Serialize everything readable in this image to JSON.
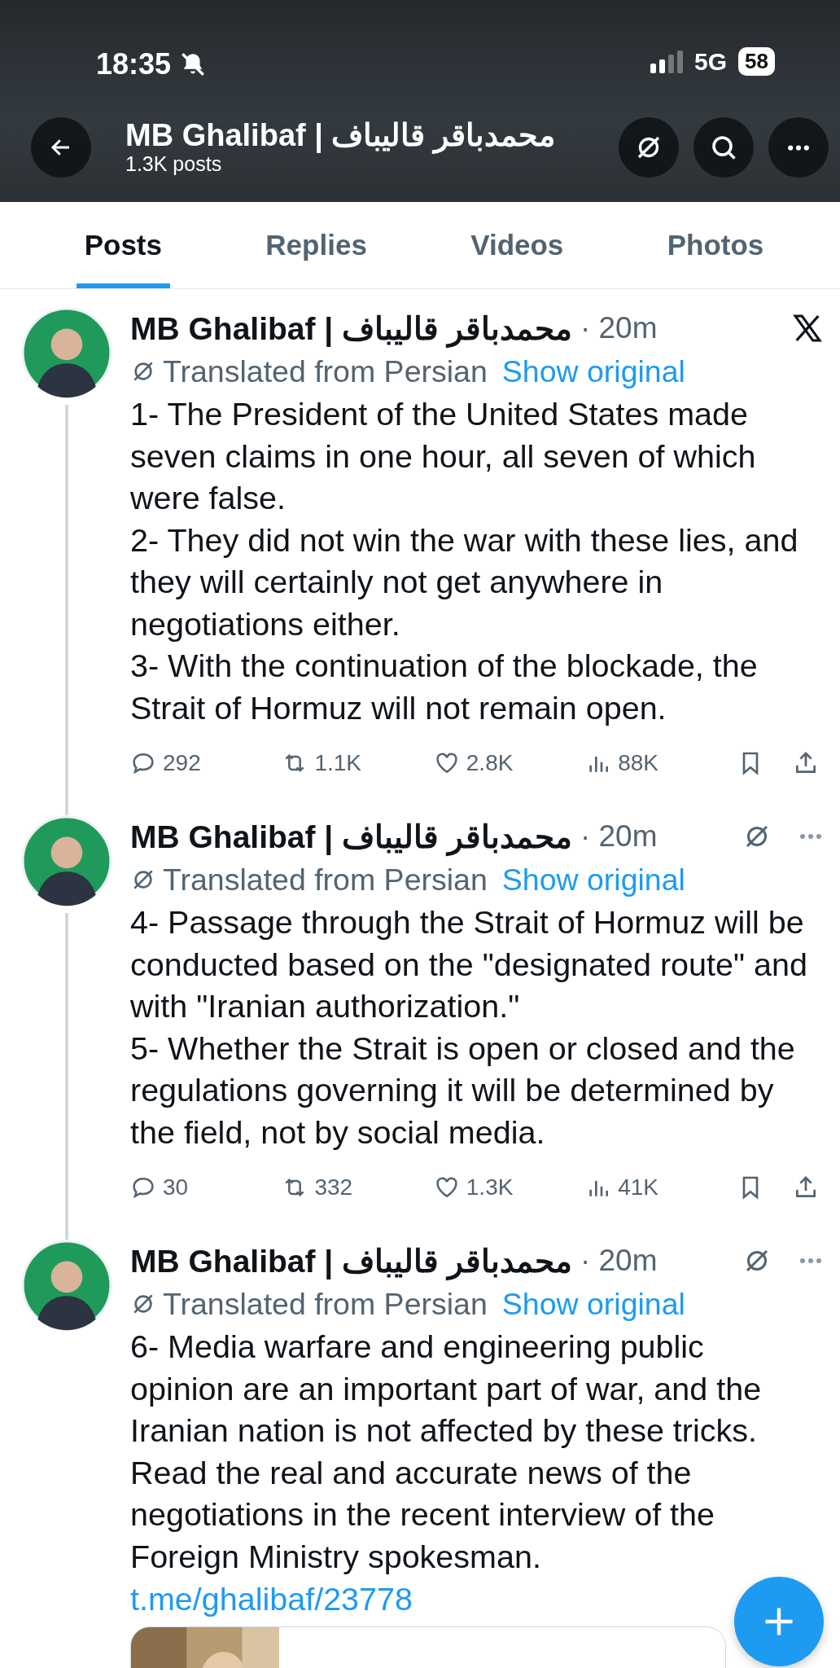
{
  "status_bar": {
    "time": "18:35",
    "network": "5G",
    "battery": "58"
  },
  "profile": {
    "name": "MB Ghalibaf | محمدباقر قالیباف",
    "posts_count": "1.3K posts"
  },
  "tabs": [
    {
      "label": "Posts",
      "selected": true
    },
    {
      "label": "Replies",
      "selected": false
    },
    {
      "label": "Videos",
      "selected": false
    },
    {
      "label": "Photos",
      "selected": false
    }
  ],
  "posts": [
    {
      "author": "MB Ghalibaf | محمدباقر قالیباف",
      "time": "· 20m",
      "kind": "logo",
      "translated": "Translated from Persian",
      "show_original": "Show original",
      "text": "1- The President of the United States made seven claims in one hour, all seven of which were false.\n2- They did not win the war with these lies, and they will certainly not get anywhere in negotiations either.\n3- With the continuation of the blockade, the Strait of Hormuz will not remain open.",
      "thread_above": false,
      "thread_below": true,
      "stats": {
        "replies": "292",
        "reposts": "1.1K",
        "likes": "2.8K",
        "views": "88K"
      }
    },
    {
      "author": "MB Ghalibaf | محمدباقر قالیباف",
      "time": "· 20m",
      "kind": "menu",
      "translated": "Translated from Persian",
      "show_original": "Show original",
      "text": "4- Passage through the Strait of Hormuz will be conducted based on the \"designated route\" and with \"Iranian authorization.\"\n5- Whether the Strait is open or closed and the regulations governing it will be determined by the field, not by social media.",
      "thread_above": true,
      "thread_below": true,
      "stats": {
        "replies": "30",
        "reposts": "332",
        "likes": "1.3K",
        "views": "41K"
      }
    },
    {
      "author": "MB Ghalibaf | محمدباقر قالیباف",
      "time": "· 20m",
      "kind": "menu",
      "translated": "Translated from Persian",
      "show_original": "Show original",
      "text": "6- Media warfare and engineering public opinion are an important part of war, and the Iranian nation is not affected by these tricks. Read the real and accurate news of the negotiations in the recent interview of the Foreign Ministry spokesman.",
      "link": "t.me/ghalibaf/23778",
      "thread_above": true,
      "thread_below": false
    }
  ]
}
